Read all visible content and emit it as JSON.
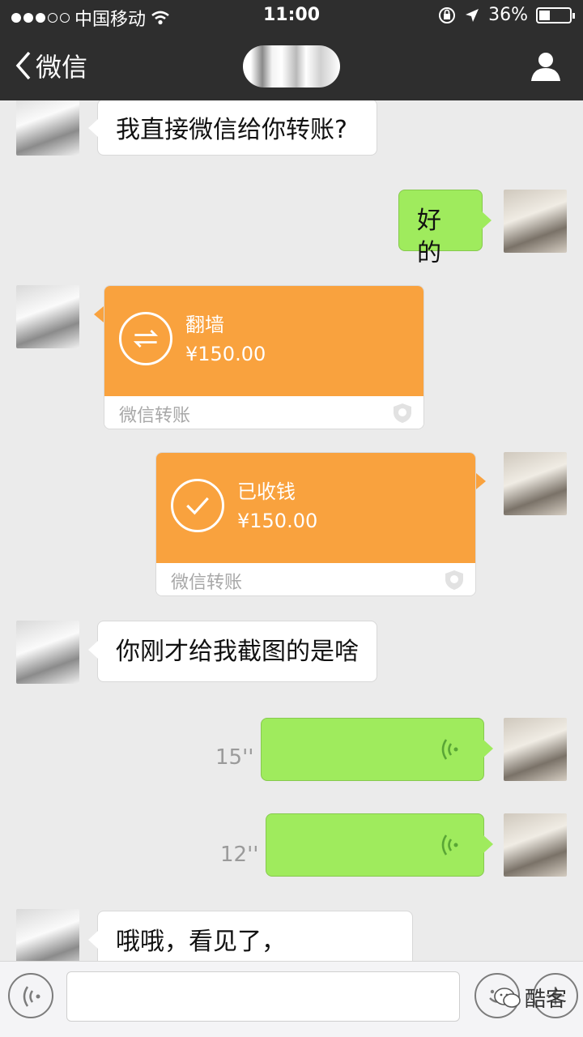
{
  "status_bar": {
    "carrier": "中国移动",
    "time": "11:00",
    "battery": "36%"
  },
  "nav": {
    "back_label": "微信"
  },
  "messages": [
    {
      "side": "left",
      "type": "text",
      "text": "我直接微信给你转账?"
    },
    {
      "side": "right",
      "type": "text",
      "text": "好的"
    },
    {
      "side": "left",
      "type": "transfer",
      "title": "翻墙",
      "amount": "¥150.00",
      "footer": "微信转账"
    },
    {
      "side": "right",
      "type": "transfer",
      "title": "已收钱",
      "amount": "¥150.00",
      "footer": "微信转账"
    },
    {
      "side": "left",
      "type": "text",
      "text": "你刚才给我截图的是啥"
    },
    {
      "side": "right",
      "type": "voice",
      "duration": "15''"
    },
    {
      "side": "right",
      "type": "voice",
      "duration": "12''"
    },
    {
      "side": "left",
      "type": "text",
      "text": "哦哦，看见了，Facebook"
    }
  ],
  "input_bar": {
    "placeholder": "",
    "watermark": "酷客"
  },
  "colors": {
    "bar": "#2e2e2e",
    "chat_bg": "#ebebeb",
    "green_bubble": "#9feb5d",
    "transfer_orange": "#f9a23e"
  }
}
